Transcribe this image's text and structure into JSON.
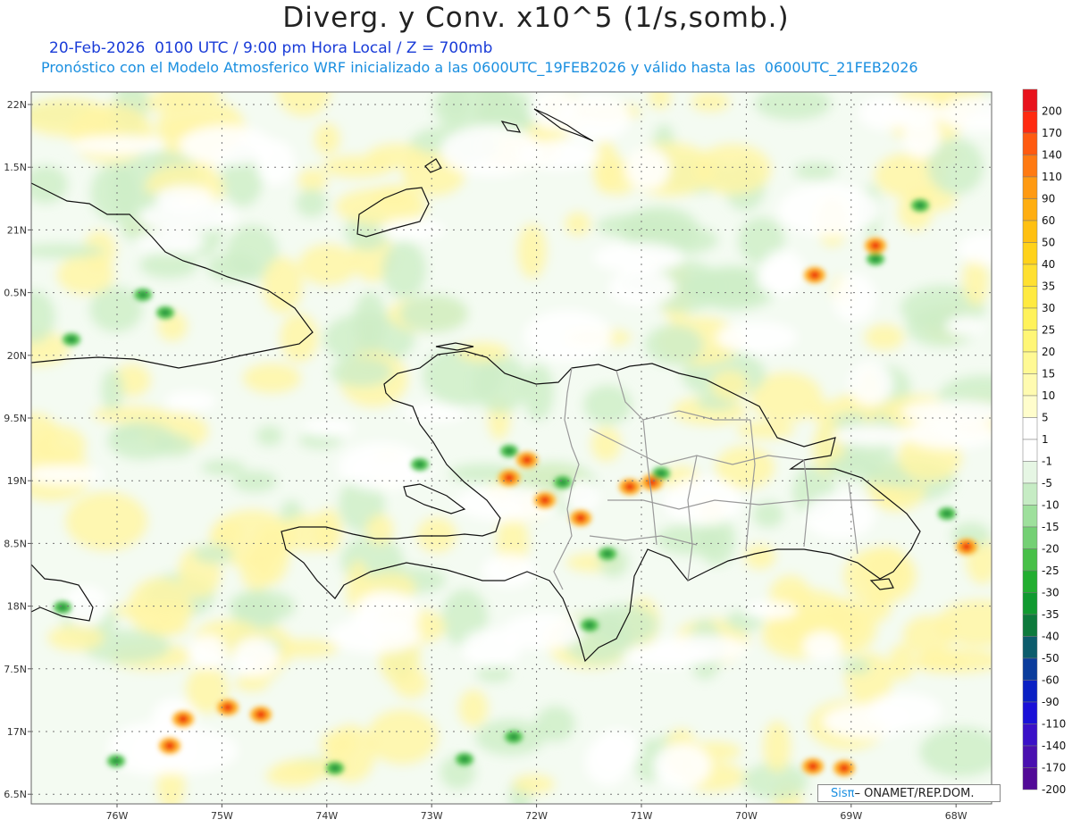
{
  "header": {
    "title": "Diverg. y Conv. x10^5 (1/s,somb.)",
    "subtitle": "20-Feb-2026  0100 UTC / 9:00 pm Hora Local / Z = 700mb",
    "model_info": "Pronóstico con el Modelo Atmosferico WRF inicializado a las 0600UTC_19FEB2026 y válido hasta las  0600UTC_21FEB2026"
  },
  "axes": {
    "lat_labels": [
      "22N",
      "1.5N",
      "21N",
      "0.5N",
      "20N",
      "9.5N",
      "19N",
      "8.5N",
      "18N",
      "7.5N",
      "17N",
      "6.5N"
    ],
    "lon_labels": [
      "76W",
      "75W",
      "74W",
      "73W",
      "72W",
      "71W",
      "70W",
      "69W",
      "68W"
    ]
  },
  "colorbar": {
    "labels": [
      "200",
      "170",
      "140",
      "110",
      "90",
      "60",
      "50",
      "40",
      "35",
      "30",
      "25",
      "20",
      "15",
      "10",
      "5",
      "1",
      "-1",
      "-5",
      "-10",
      "-15",
      "-20",
      "-25",
      "-30",
      "-35",
      "-40",
      "-50",
      "-60",
      "-90",
      "-110",
      "-140",
      "-170",
      "-200"
    ],
    "colors": [
      "#e8121c",
      "#ff2a10",
      "#ff5a10",
      "#ff7a12",
      "#ff9a12",
      "#ffae10",
      "#ffc010",
      "#ffd21a",
      "#ffe030",
      "#ffea40",
      "#fff25a",
      "#fff676",
      "#fff994",
      "#fffbb0",
      "#fffdcc",
      "#ffffff",
      "#ffffff",
      "#e6f6e4",
      "#c6ecc4",
      "#9ee09c",
      "#74d074",
      "#48c048",
      "#22ae30",
      "#109a30",
      "#0d7a3c",
      "#0c5c6c",
      "#0a3c9c",
      "#0a20c4",
      "#1a10d8",
      "#3a10c8",
      "#4a10b0",
      "#520a98"
    ]
  },
  "map": {
    "background": "#ffffff",
    "coast_color": "#111111",
    "border_color": "#9a9a9a",
    "divergence_color": "#fff6a6",
    "convergence_color": "#cfeec8"
  },
  "credit": {
    "logo": "Sisπ",
    "text": "– ONAMET/REP.DOM."
  }
}
